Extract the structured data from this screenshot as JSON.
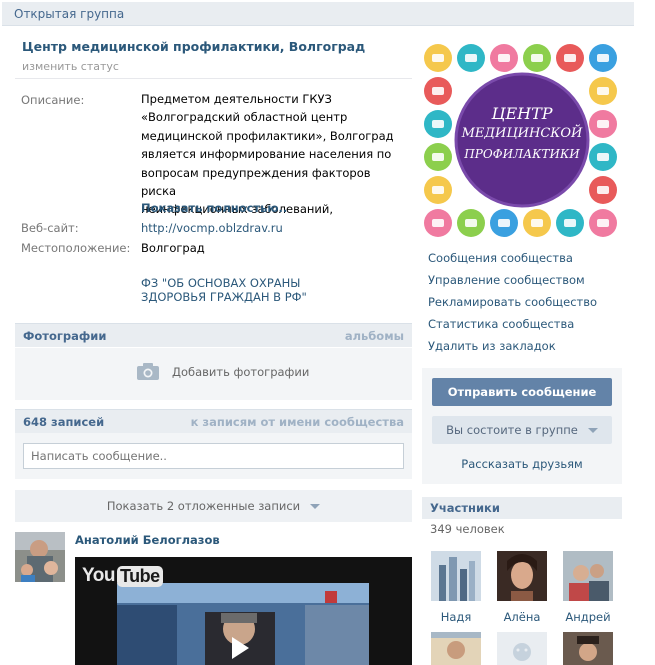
{
  "header": {
    "title": "Открытая группа"
  },
  "group": {
    "name": "Центр медицинской профилактики, Волгоград",
    "status_link": "изменить статус",
    "info": {
      "description_label": "Описание:",
      "description_lines": [
        "Предметом деятельности ГКУЗ",
        "«Волгоградский областной центр",
        "медицинской профилактики», Волгоград",
        "является информирование населения по",
        "вопросам предупреждения факторов риска",
        "неинфекционных заболеваний,"
      ],
      "show_more": "Показать полностью..",
      "website_label": "Веб-сайт:",
      "website": "http://vocmp.oblzdrav.ru",
      "location_label": "Местоположение:",
      "location": "Волгоград",
      "law_lines": [
        "ФЗ \"ОБ ОСНОВАХ ОХРАНЫ",
        "ЗДОРОВЬЯ ГРАЖДАН В РФ\""
      ]
    },
    "logo_text": [
      "ЦЕНТР",
      "МЕДИЦИНСКОЙ",
      "ПРОФИЛАКТИКИ"
    ]
  },
  "photos": {
    "title": "Фотографии",
    "albums_link": "альбомы",
    "add_label": "Добавить фотографии"
  },
  "wall": {
    "count_label": "648 записей",
    "community_link": "к записям от имени сообщества",
    "input_placeholder": "Написать сообщение..",
    "postponed_label": "Показать 2 отложенные записи",
    "post_author": "Анатолий Белоглазов",
    "video_logo": "You",
    "video_logo_tube": "Tube"
  },
  "sidebar": {
    "links": [
      "Сообщения сообщества",
      "Управление сообществом",
      "Рекламировать сообщество",
      "Статистика сообщества",
      "Удалить из закладок"
    ],
    "send_message": "Отправить сообщение",
    "member_status": "Вы состоите в группе",
    "tell_friends": "Рассказать друзьям"
  },
  "members": {
    "title": "Участники",
    "count": "349 человек",
    "list": [
      "Надя",
      "Алёна",
      "Андрей"
    ]
  },
  "colors": {
    "link": "#2b587a",
    "header_bg": "#e9edf1",
    "button": "#6383a8",
    "logo_purple": "#5c2d8a"
  }
}
